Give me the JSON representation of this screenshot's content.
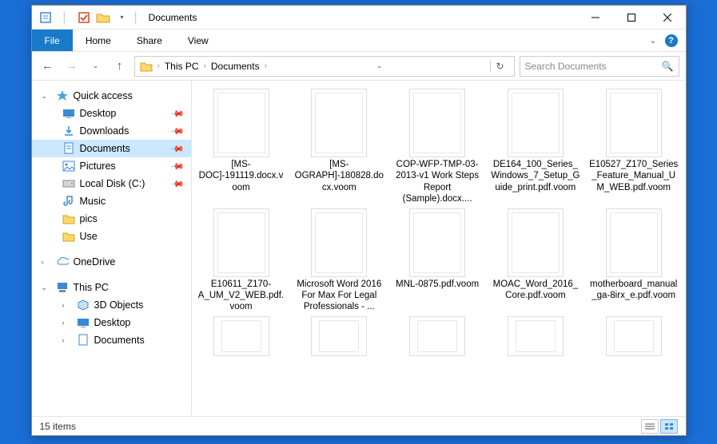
{
  "window": {
    "title": "Documents"
  },
  "ribbon": {
    "file": "File",
    "tabs": [
      "Home",
      "Share",
      "View"
    ]
  },
  "address": {
    "root": "This PC",
    "crumb": "Documents",
    "search_placeholder": "Search Documents"
  },
  "sidebar": {
    "quick_access": "Quick access",
    "items": [
      {
        "label": "Desktop",
        "pinned": true
      },
      {
        "label": "Downloads",
        "pinned": true
      },
      {
        "label": "Documents",
        "pinned": true,
        "selected": true
      },
      {
        "label": "Pictures",
        "pinned": true
      },
      {
        "label": "Local Disk (C:)",
        "pinned": true
      },
      {
        "label": "Music",
        "pinned": false
      },
      {
        "label": "pics",
        "pinned": false
      },
      {
        "label": "Use",
        "pinned": false
      }
    ],
    "onedrive": "OneDrive",
    "this_pc": "This PC",
    "pc_items": [
      {
        "label": "3D Objects"
      },
      {
        "label": "Desktop"
      },
      {
        "label": "Documents"
      }
    ]
  },
  "files": {
    "row1": [
      "[MS-DOC]-191119.docx.voom",
      "[MS-OGRAPH]-180828.docx.voom",
      "COP-WFP-TMP-03-2013-v1 Work Steps Report (Sample).docx....",
      "DE164_100_Series_Windows_7_Setup_Guide_print.pdf.voom",
      "E10527_Z170_Series_Feature_Manual_UM_WEB.pdf.voom"
    ],
    "row2": [
      "E10611_Z170-A_UM_V2_WEB.pdf.voom",
      "Microsoft Word 2016 For Max For Legal Professionals - ...",
      "MNL-0875.pdf.voom",
      "MOAC_Word_2016_Core.pdf.voom",
      "motherboard_manual_ga-8irx_e.pdf.voom"
    ]
  },
  "status": {
    "count": "15 items"
  }
}
